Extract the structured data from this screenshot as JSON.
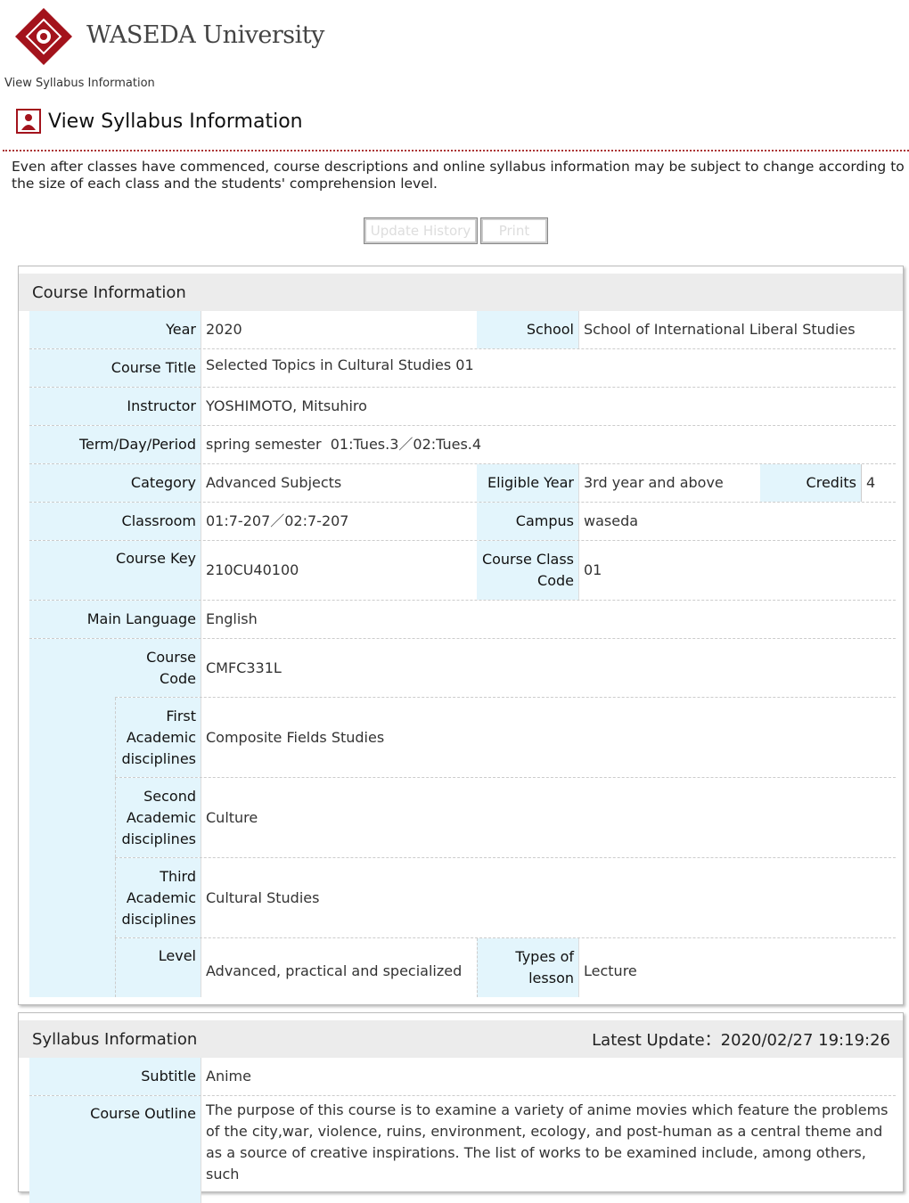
{
  "brand": {
    "name": "WASEDA University"
  },
  "breadcrumb": "View Syllabus Information",
  "page_title": "View Syllabus Information",
  "notice": "Even after classes have commenced, course descriptions and online syllabus information may be subject to change according to the size of each class and the students' comprehension level.",
  "buttons": {
    "update_history": "Update History",
    "print": "Print"
  },
  "course_info": {
    "heading": "Course Information",
    "year_label": "Year",
    "year": "2020",
    "school_label": "School",
    "school": "School of International Liberal Studies",
    "title_label": "Course Title",
    "title": "Selected Topics in Cultural Studies 01",
    "instructor_label": "Instructor",
    "instructor": "YOSHIMOTO, Mitsuhiro",
    "term_label": "Term/Day/Period",
    "term": "spring semester  01:Tues.3／02:Tues.4",
    "category_label": "Category",
    "category": "Advanced Subjects",
    "eligible_label": "Eligible Year",
    "eligible": "3rd year and above",
    "credits_label": "Credits",
    "credits": "4",
    "classroom_label": "Classroom",
    "classroom": "01:7-207／02:7-207",
    "campus_label": "Campus",
    "campus": "waseda",
    "key_label": "Course Key",
    "key": "210CU40100",
    "class_code_label": "Course Class Code",
    "class_code": "01",
    "language_label": "Main Language",
    "language": "English",
    "course_code_label": "Course Code",
    "course_code": "CMFC331L",
    "first_label": "First Academic disciplines",
    "first": "Composite Fields Studies",
    "second_label": "Second Academic disciplines",
    "second": "Culture",
    "third_label": "Third Academic disciplines",
    "third": "Cultural Studies",
    "level_label": "Level",
    "level": "Advanced, practical and specialized",
    "lesson_label": "Types of lesson",
    "lesson": "Lecture"
  },
  "syllabus_info": {
    "heading": "Syllabus Information",
    "latest_update": "Latest Update：2020/02/27 19:19:26",
    "subtitle_label": "Subtitle",
    "subtitle": "Anime",
    "outline_label": "Course Outline",
    "outline": "The purpose of this course is to examine a variety of anime movies which feature the problems of the city,war, violence, ruins, environment, ecology, and post-human as a central theme and as a source of creative inspirations. The list of works to be examined include, among others, such"
  },
  "colors": {
    "brand_red": "#a3131c",
    "label_bg": "#e3f5fc"
  }
}
